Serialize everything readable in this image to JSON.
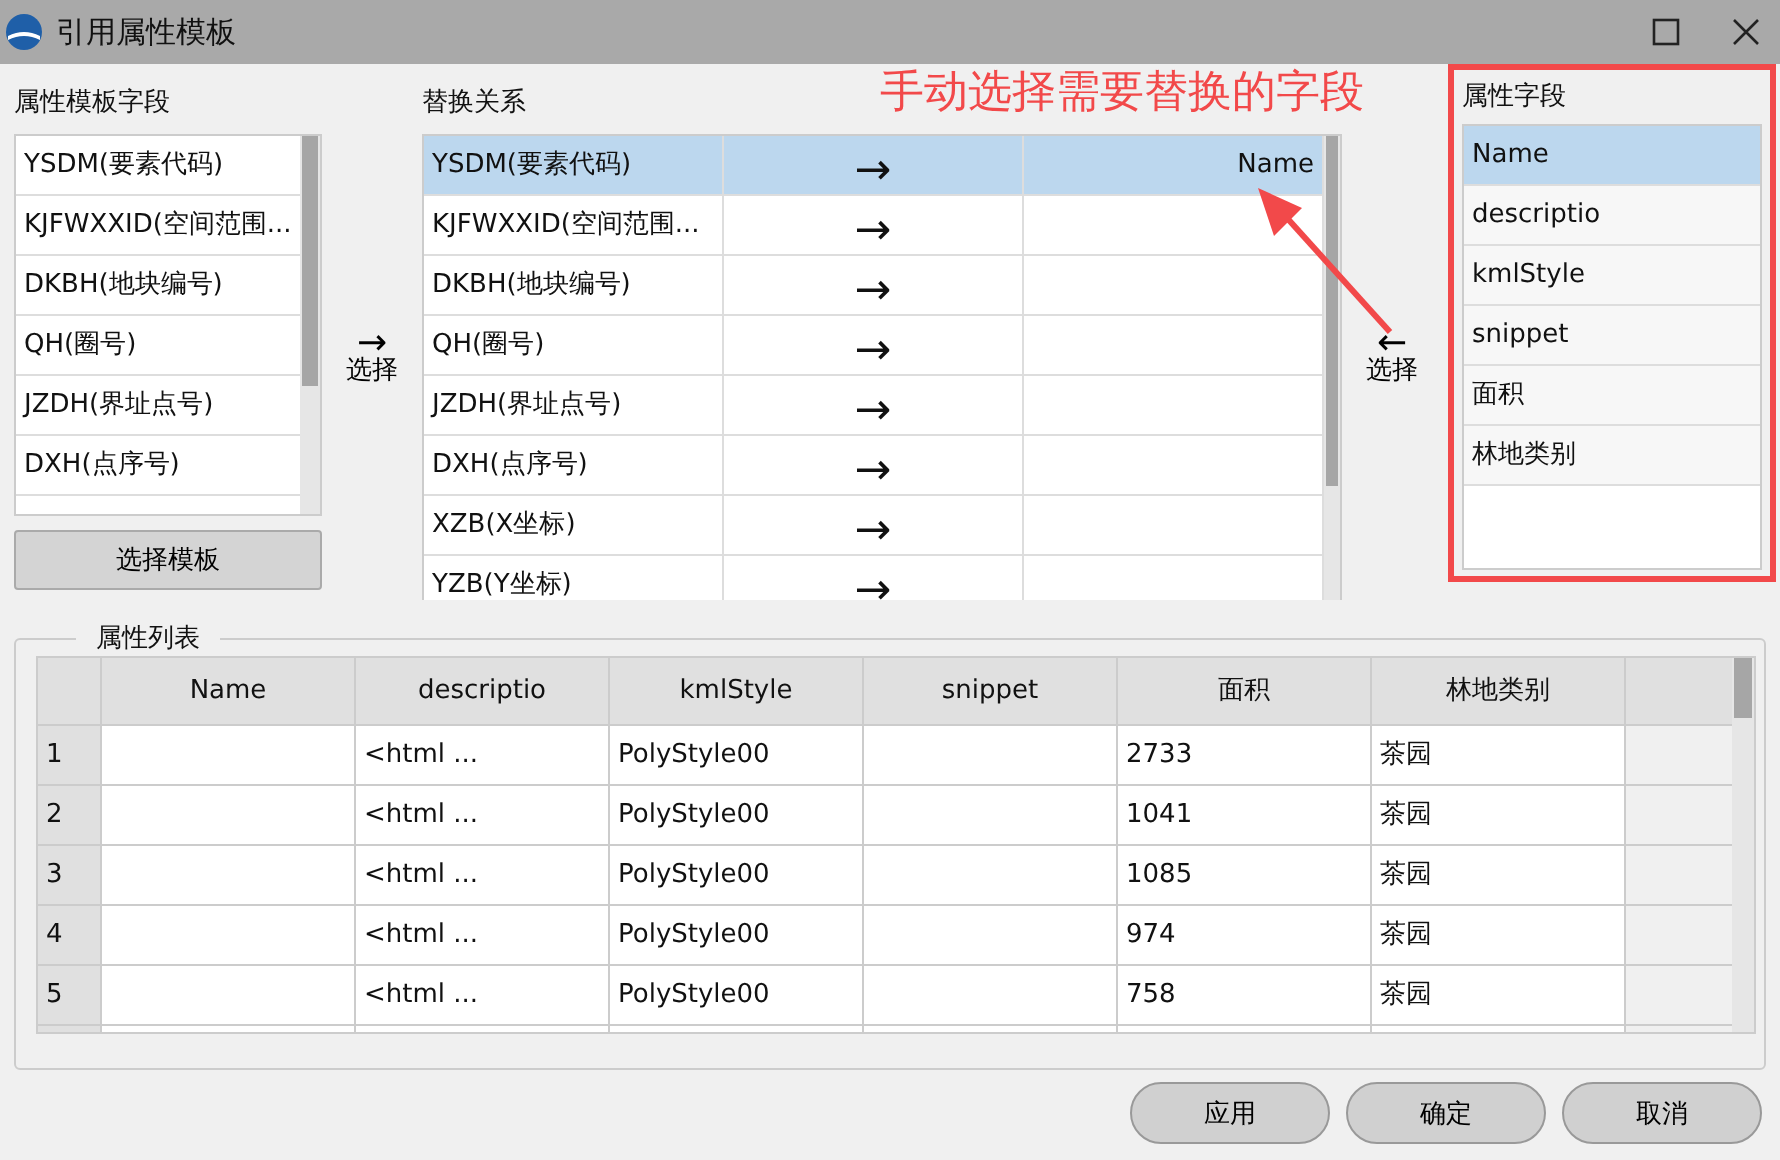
{
  "window": {
    "title": "引用属性模板"
  },
  "template_fields": {
    "label": "属性模板字段",
    "items": [
      "YSDM(要素代码)",
      "KJFWXXID(空间范围...",
      "DKBH(地块编号)",
      "QH(圈号)",
      "JZDH(界址点号)",
      "DXH(点序号)"
    ],
    "button": "选择模板"
  },
  "select_right": {
    "arrow": "→",
    "label": "选择"
  },
  "replace": {
    "label": "替换关系",
    "rows": [
      {
        "source": "YSDM(要素代码)",
        "arrow": "→",
        "target": "Name",
        "selected": true
      },
      {
        "source": "KJFWXXID(空间范围...",
        "arrow": "→",
        "selected": false
      },
      {
        "source": "DKBH(地块编号)",
        "arrow": "→",
        "selected": false
      },
      {
        "source": "QH(圈号)",
        "arrow": "→",
        "selected": false
      },
      {
        "source": "JZDH(界址点号)",
        "arrow": "→",
        "selected": false
      },
      {
        "source": "DXH(点序号)",
        "arrow": "→",
        "selected": false
      },
      {
        "source": "XZB(X坐标)",
        "arrow": "→",
        "selected": false
      },
      {
        "source": "YZB(Y坐标)",
        "arrow": "→",
        "selected": false
      }
    ]
  },
  "annotation": "手动选择需要替换的字段",
  "select_left": {
    "arrow": "←",
    "label": "选择"
  },
  "attribute_fields": {
    "label": "属性字段",
    "items": [
      {
        "text": "Name",
        "selected": true
      },
      {
        "text": "descriptio",
        "selected": false
      },
      {
        "text": "kmlStyle",
        "selected": false
      },
      {
        "text": "snippet",
        "selected": false
      },
      {
        "text": "面积",
        "selected": false
      },
      {
        "text": "林地类别",
        "selected": false
      }
    ]
  },
  "attribute_list": {
    "label": "属性列表",
    "columns": [
      "Name",
      "descriptio",
      "kmlStyle",
      "snippet",
      "面积",
      "林地类别"
    ],
    "rows": [
      {
        "number": "1",
        "descriptio": "<html ...",
        "kmlStyle": "PolyStyle00",
        "area": "2733",
        "type": "茶园"
      },
      {
        "number": "2",
        "descriptio": "<html ...",
        "kmlStyle": "PolyStyle00",
        "area": "1041",
        "type": "茶园"
      },
      {
        "number": "3",
        "descriptio": "<html ...",
        "kmlStyle": "PolyStyle00",
        "area": "1085",
        "type": "茶园"
      },
      {
        "number": "4",
        "descriptio": "<html ...",
        "kmlStyle": "PolyStyle00",
        "area": "974",
        "type": "茶园"
      },
      {
        "number": "5",
        "descriptio": "<html ...",
        "kmlStyle": "PolyStyle00",
        "area": "758",
        "type": "茶园"
      }
    ]
  },
  "buttons": [
    "应用",
    "确定",
    "取消"
  ]
}
